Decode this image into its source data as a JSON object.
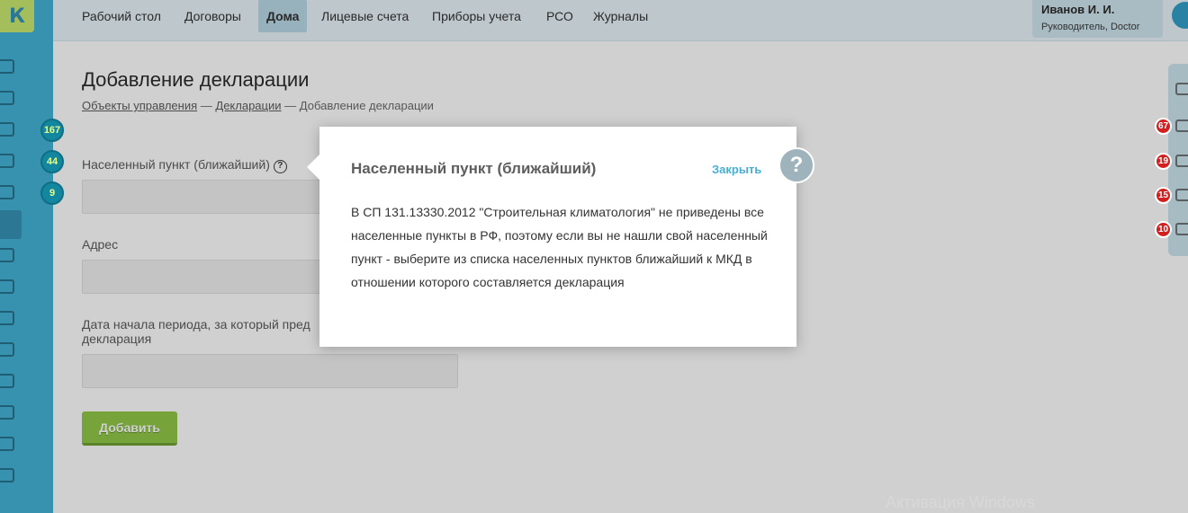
{
  "logo": {
    "letter": "К"
  },
  "nav": {
    "items": [
      {
        "label": "Рабочий стол"
      },
      {
        "label": "Договоры"
      },
      {
        "label": "Дома"
      },
      {
        "label": "Лицевые счета"
      },
      {
        "label": "Приборы учета"
      },
      {
        "label": "РСО"
      },
      {
        "label": "Журналы"
      }
    ],
    "active": "Дома"
  },
  "user": {
    "name": "Иванов И. И.",
    "role": "Руководитель, Doctor"
  },
  "sidebar": {
    "badges": [
      "167",
      "44",
      "9"
    ]
  },
  "right_panel": {
    "badges": [
      "67",
      "19",
      "15",
      "10"
    ]
  },
  "page": {
    "title": "Добавление декларации",
    "breadcrumb": {
      "link1": "Объекты управления",
      "sep": "—",
      "link2": "Декларации",
      "current": "Добавление декларации"
    }
  },
  "form": {
    "field1_label": "Населенный пункт (ближайший)",
    "field2_label": "Адрес",
    "field3_label": "Дата начала периода, за который пред",
    "field3_label_cont": "декларация",
    "add_button": "Добавить"
  },
  "modal": {
    "title": "Населенный пункт (ближайший)",
    "close": "Закрыть",
    "help": "?",
    "body": "В СП 131.13330.2012 \"Строительная климатология\" не приведены все населенные пункты в РФ, поэтому если вы не нашли свой населенный пункт - выберите из списка населенных пунктов ближайший к МКД в отношении которого составляется декларация"
  },
  "watermark": "Активация Windows",
  "colors": {
    "sidebar": "#3bb0d6",
    "accent": "#4aaed3",
    "button": "#8cc63f",
    "badge_red": "#d21f1f"
  }
}
